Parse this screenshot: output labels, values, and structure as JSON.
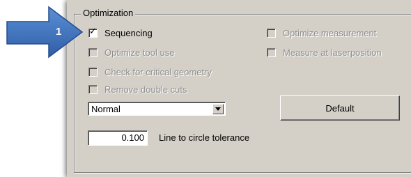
{
  "callout": {
    "number": "1",
    "color": "#3d6fb6"
  },
  "optimization": {
    "title": "Optimization",
    "options": [
      {
        "label": "Sequencing",
        "checked": true,
        "enabled": true
      },
      {
        "label": "Optimize tool use",
        "checked": false,
        "enabled": false
      },
      {
        "label": "Check for critical geometry",
        "checked": false,
        "enabled": false
      },
      {
        "label": "Remove double cuts",
        "checked": false,
        "enabled": false
      },
      {
        "label": "Optimize measurement",
        "checked": false,
        "enabled": false
      },
      {
        "label": "Measure at laserposition",
        "checked": false,
        "enabled": false
      }
    ],
    "mode_select": {
      "value": "Normal"
    },
    "default_button": {
      "label": "Default"
    },
    "tolerance": {
      "value": "0.100",
      "label": "Line to circle tolerance"
    }
  }
}
